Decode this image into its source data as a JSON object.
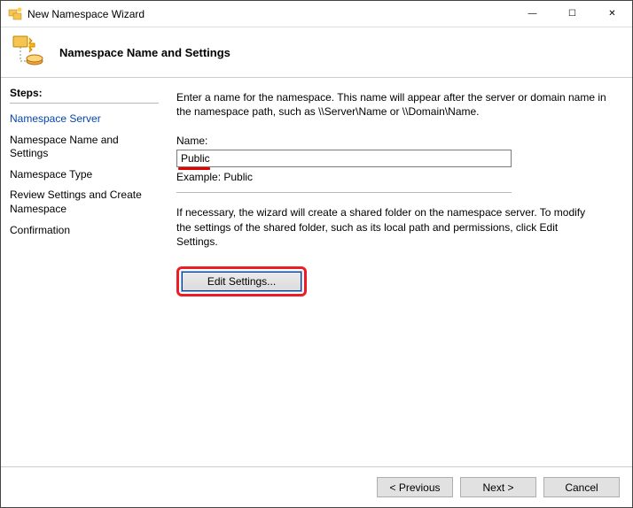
{
  "window": {
    "title": "New Namespace Wizard",
    "minimize": "—",
    "maximize": "☐",
    "close": "✕"
  },
  "header": {
    "title": "Namespace Name and Settings"
  },
  "steps": {
    "heading": "Steps:",
    "items": [
      {
        "label": "Namespace Server",
        "state": "done"
      },
      {
        "label": "Namespace Name and Settings",
        "state": "current"
      },
      {
        "label": "Namespace Type",
        "state": "future"
      },
      {
        "label": "Review Settings and Create Namespace",
        "state": "future"
      },
      {
        "label": "Confirmation",
        "state": "future"
      }
    ]
  },
  "main": {
    "intro": "Enter a name for the namespace. This name will appear after the server or domain name in the namespace path, such as \\\\Server\\Name or \\\\Domain\\Name.",
    "name_label": "Name:",
    "name_value": "Public",
    "example": "Example: Public",
    "shared_text": "If necessary, the wizard will create a shared folder on the namespace server. To modify the settings of the shared folder, such as its local path and permissions, click Edit Settings.",
    "edit_button": "Edit Settings..."
  },
  "footer": {
    "previous": "< Previous",
    "next": "Next >",
    "cancel": "Cancel"
  }
}
